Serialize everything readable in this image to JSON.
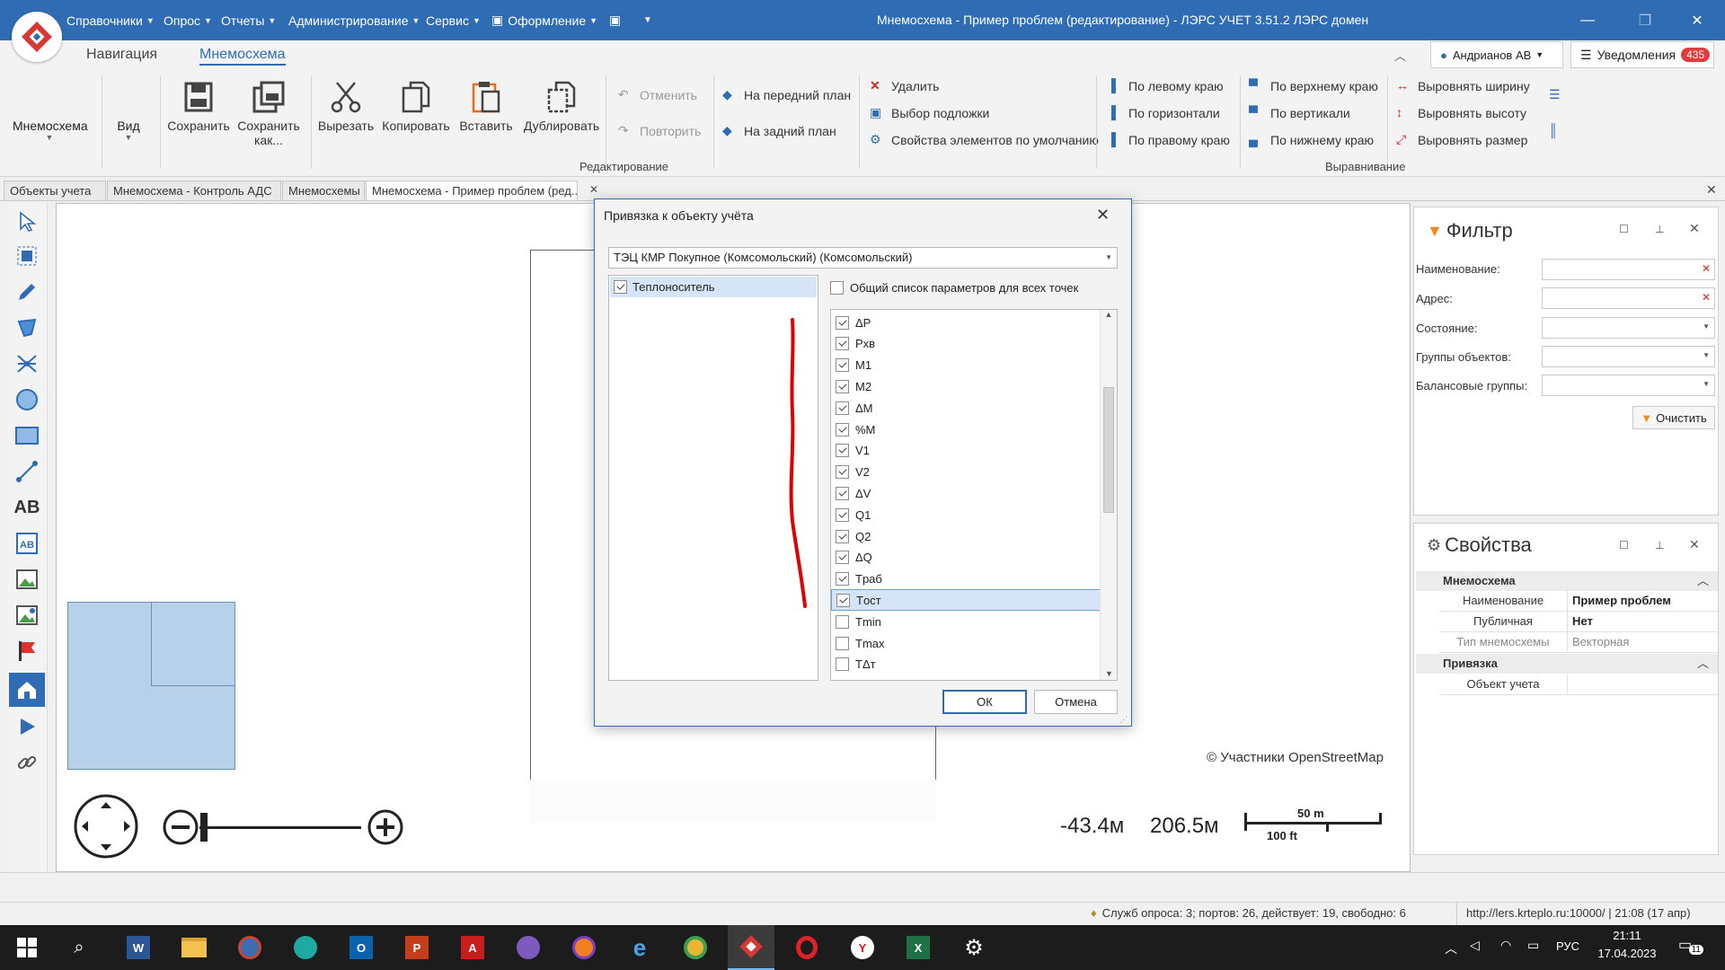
{
  "window": {
    "title": "Мнемосхема - Пример проблем (редактирование) - ЛЭРС УЧЕТ 3.51.2 ЛЭРС домен",
    "menu": [
      "Справочники",
      "Опрос",
      "Отчеты",
      "Администрирование",
      "Сервис",
      "Оформление"
    ]
  },
  "ribbon": {
    "tabs": [
      "Навигация",
      "Мнемосхема"
    ],
    "left_buttons": {
      "mnemo": "Мнемосхема",
      "view": "Вид"
    },
    "big_buttons": [
      "Сохранить",
      "Сохранить как...",
      "Вырезать",
      "Копировать",
      "Вставить",
      "Дублировать"
    ],
    "undo": "Отменить",
    "redo": "Повторить",
    "front": "На передний план",
    "back": "На задний план",
    "delete": "Удалить",
    "underlay": "Выбор подложки",
    "default_props": "Свойства элементов по умолчанию",
    "align_left": "По левому краю",
    "align_hcenter": "По горизонтали",
    "align_right": "По правому краю",
    "align_top": "По верхнему краю",
    "align_vcenter": "По вертикали",
    "align_bottom": "По нижнему краю",
    "equal_width": "Выровнять ширину",
    "equal_height": "Выровнять высоту",
    "equal_size": "Выровнять размер",
    "group_edit": "Редактирование",
    "group_align": "Выравнивание"
  },
  "user": {
    "name": "Андрианов АВ",
    "notifications_label": "Уведомления",
    "notifications_count": "435"
  },
  "doc_tabs": [
    "Объекты учета",
    "Мнемосхема - Контроль АДС",
    "Мнемосхемы",
    "Мнемосхема - Пример проблем (ред..."
  ],
  "canvas": {
    "attribution": "© Участники OpenStreetMap",
    "coord_x": "-43.4м",
    "coord_y": "206.5м",
    "scale_m": "50 m",
    "scale_ft": "100 ft"
  },
  "filter_panel": {
    "title": "Фильтр",
    "fields": [
      "Наименование:",
      "Адрес:",
      "Состояние:",
      "Группы объектов:",
      "Балансовые группы:"
    ],
    "clear_button": "Очистить"
  },
  "props_panel": {
    "title": "Свойства",
    "section1": "Мнемосхема",
    "rows": [
      {
        "key": "Наименование",
        "value": "Пример проблем"
      },
      {
        "key": "Публичная",
        "value": "Нет"
      },
      {
        "key": "Тип мнемосхемы",
        "value": "Векторная"
      }
    ],
    "section2": "Привязка",
    "binding_key": "Объект учета"
  },
  "dialog": {
    "title": "Привязка к объекту учёта",
    "object_select": "ТЭЦ КМР Покупное (Комсомольский) (Комсомольский)",
    "resource": "Теплоноситель",
    "common_list": "Общий список параметров для всех точек",
    "params": [
      {
        "name": "ΔP",
        "checked": true
      },
      {
        "name": "Pхв",
        "checked": true
      },
      {
        "name": "M1",
        "checked": true
      },
      {
        "name": "M2",
        "checked": true
      },
      {
        "name": "ΔM",
        "checked": true
      },
      {
        "name": "%M",
        "checked": true
      },
      {
        "name": "V1",
        "checked": true
      },
      {
        "name": "V2",
        "checked": true
      },
      {
        "name": "ΔV",
        "checked": true
      },
      {
        "name": "Q1",
        "checked": true
      },
      {
        "name": "Q2",
        "checked": true
      },
      {
        "name": "ΔQ",
        "checked": true
      },
      {
        "name": "Tраб",
        "checked": true
      },
      {
        "name": "Tост",
        "checked": true
      },
      {
        "name": "Tmin",
        "checked": false
      },
      {
        "name": "Tmax",
        "checked": false
      },
      {
        "name": "TΔт",
        "checked": false
      }
    ],
    "ok": "ОК",
    "cancel": "Отмена"
  },
  "statusbar": {
    "services": "Служб опроса: 3; портов: 26, действует: 19, свободно: 6",
    "server": "http://lers.krteplo.ru:10000/ | 21:08 (17 апр)"
  },
  "taskbar": {
    "lang": "РУС",
    "time": "21:11",
    "date": "17.04.2023",
    "notif_count": "11"
  },
  "colors": {
    "accent": "#2f6cb3",
    "badge": "#e23b3b",
    "annotation": "#e00000"
  }
}
